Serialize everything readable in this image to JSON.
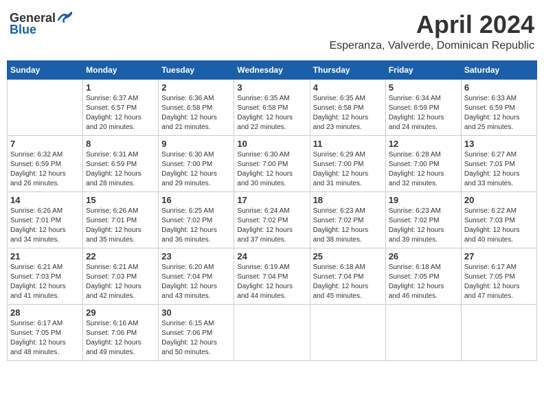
{
  "logo": {
    "general": "General",
    "blue": "Blue"
  },
  "header": {
    "title": "April 2024",
    "subtitle": "Esperanza, Valverde, Dominican Republic"
  },
  "weekdays": [
    "Sunday",
    "Monday",
    "Tuesday",
    "Wednesday",
    "Thursday",
    "Friday",
    "Saturday"
  ],
  "weeks": [
    [
      {
        "day": "",
        "info": ""
      },
      {
        "day": "1",
        "info": "Sunrise: 6:37 AM\nSunset: 6:57 PM\nDaylight: 12 hours\nand 20 minutes."
      },
      {
        "day": "2",
        "info": "Sunrise: 6:36 AM\nSunset: 6:58 PM\nDaylight: 12 hours\nand 21 minutes."
      },
      {
        "day": "3",
        "info": "Sunrise: 6:35 AM\nSunset: 6:58 PM\nDaylight: 12 hours\nand 22 minutes."
      },
      {
        "day": "4",
        "info": "Sunrise: 6:35 AM\nSunset: 6:58 PM\nDaylight: 12 hours\nand 23 minutes."
      },
      {
        "day": "5",
        "info": "Sunrise: 6:34 AM\nSunset: 6:59 PM\nDaylight: 12 hours\nand 24 minutes."
      },
      {
        "day": "6",
        "info": "Sunrise: 6:33 AM\nSunset: 6:59 PM\nDaylight: 12 hours\nand 25 minutes."
      }
    ],
    [
      {
        "day": "7",
        "info": "Sunrise: 6:32 AM\nSunset: 6:59 PM\nDaylight: 12 hours\nand 26 minutes."
      },
      {
        "day": "8",
        "info": "Sunrise: 6:31 AM\nSunset: 6:59 PM\nDaylight: 12 hours\nand 28 minutes."
      },
      {
        "day": "9",
        "info": "Sunrise: 6:30 AM\nSunset: 7:00 PM\nDaylight: 12 hours\nand 29 minutes."
      },
      {
        "day": "10",
        "info": "Sunrise: 6:30 AM\nSunset: 7:00 PM\nDaylight: 12 hours\nand 30 minutes."
      },
      {
        "day": "11",
        "info": "Sunrise: 6:29 AM\nSunset: 7:00 PM\nDaylight: 12 hours\nand 31 minutes."
      },
      {
        "day": "12",
        "info": "Sunrise: 6:28 AM\nSunset: 7:00 PM\nDaylight: 12 hours\nand 32 minutes."
      },
      {
        "day": "13",
        "info": "Sunrise: 6:27 AM\nSunset: 7:01 PM\nDaylight: 12 hours\nand 33 minutes."
      }
    ],
    [
      {
        "day": "14",
        "info": "Sunrise: 6:26 AM\nSunset: 7:01 PM\nDaylight: 12 hours\nand 34 minutes."
      },
      {
        "day": "15",
        "info": "Sunrise: 6:26 AM\nSunset: 7:01 PM\nDaylight: 12 hours\nand 35 minutes."
      },
      {
        "day": "16",
        "info": "Sunrise: 6:25 AM\nSunset: 7:02 PM\nDaylight: 12 hours\nand 36 minutes."
      },
      {
        "day": "17",
        "info": "Sunrise: 6:24 AM\nSunset: 7:02 PM\nDaylight: 12 hours\nand 37 minutes."
      },
      {
        "day": "18",
        "info": "Sunrise: 6:23 AM\nSunset: 7:02 PM\nDaylight: 12 hours\nand 38 minutes."
      },
      {
        "day": "19",
        "info": "Sunrise: 6:23 AM\nSunset: 7:02 PM\nDaylight: 12 hours\nand 39 minutes."
      },
      {
        "day": "20",
        "info": "Sunrise: 6:22 AM\nSunset: 7:03 PM\nDaylight: 12 hours\nand 40 minutes."
      }
    ],
    [
      {
        "day": "21",
        "info": "Sunrise: 6:21 AM\nSunset: 7:03 PM\nDaylight: 12 hours\nand 41 minutes."
      },
      {
        "day": "22",
        "info": "Sunrise: 6:21 AM\nSunset: 7:03 PM\nDaylight: 12 hours\nand 42 minutes."
      },
      {
        "day": "23",
        "info": "Sunrise: 6:20 AM\nSunset: 7:04 PM\nDaylight: 12 hours\nand 43 minutes."
      },
      {
        "day": "24",
        "info": "Sunrise: 6:19 AM\nSunset: 7:04 PM\nDaylight: 12 hours\nand 44 minutes."
      },
      {
        "day": "25",
        "info": "Sunrise: 6:18 AM\nSunset: 7:04 PM\nDaylight: 12 hours\nand 45 minutes."
      },
      {
        "day": "26",
        "info": "Sunrise: 6:18 AM\nSunset: 7:05 PM\nDaylight: 12 hours\nand 46 minutes."
      },
      {
        "day": "27",
        "info": "Sunrise: 6:17 AM\nSunset: 7:05 PM\nDaylight: 12 hours\nand 47 minutes."
      }
    ],
    [
      {
        "day": "28",
        "info": "Sunrise: 6:17 AM\nSunset: 7:05 PM\nDaylight: 12 hours\nand 48 minutes."
      },
      {
        "day": "29",
        "info": "Sunrise: 6:16 AM\nSunset: 7:06 PM\nDaylight: 12 hours\nand 49 minutes."
      },
      {
        "day": "30",
        "info": "Sunrise: 6:15 AM\nSunset: 7:06 PM\nDaylight: 12 hours\nand 50 minutes."
      },
      {
        "day": "",
        "info": ""
      },
      {
        "day": "",
        "info": ""
      },
      {
        "day": "",
        "info": ""
      },
      {
        "day": "",
        "info": ""
      }
    ]
  ]
}
